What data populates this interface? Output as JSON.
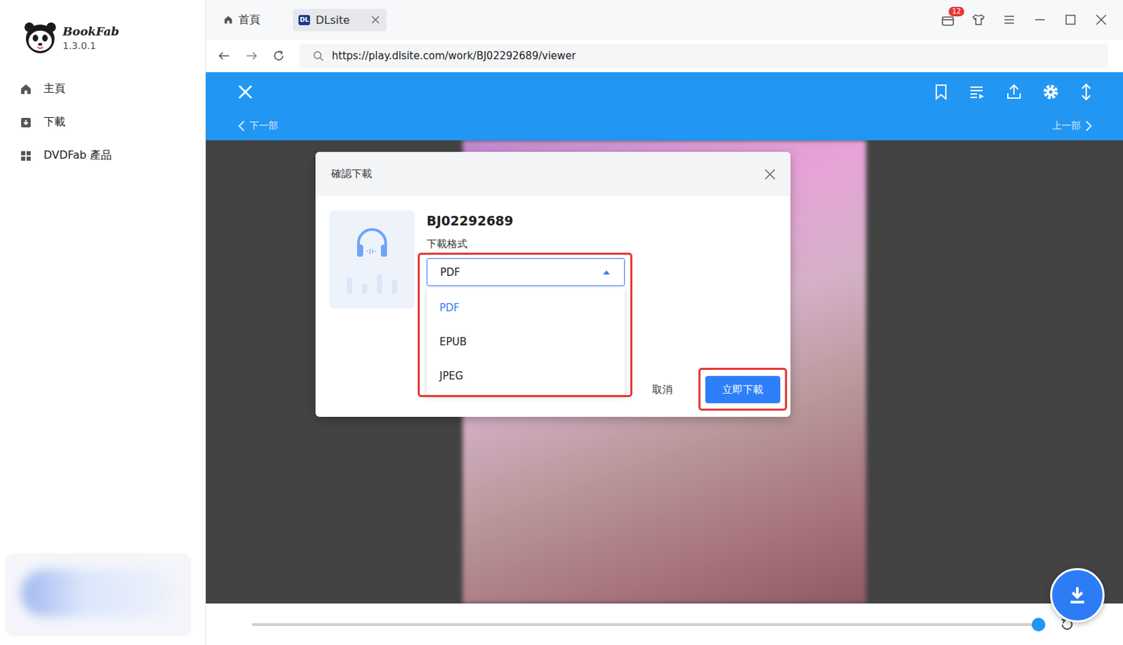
{
  "app": {
    "name": "BookFab",
    "version": "1.3.0.1"
  },
  "sidebar": {
    "items": [
      {
        "label": "主頁",
        "kind": "home",
        "selected": false
      },
      {
        "label": "下載",
        "kind": "download",
        "selected": false
      },
      {
        "label": "DVDFab 產品",
        "kind": "grid",
        "selected": false
      }
    ]
  },
  "tabs": [
    {
      "label": "首頁",
      "kind": "home",
      "badge": "",
      "closable": false,
      "selected": false
    },
    {
      "label": "DLsite",
      "kind": "site",
      "badge": "DL",
      "closable": true,
      "selected": true
    }
  ],
  "notifications": {
    "count": "12"
  },
  "address": {
    "url": "https://play.dlsite.com/work/BJ02292689/viewer"
  },
  "viewer": {
    "prev": "下一部",
    "next": "上一部",
    "progress": {
      "level": 1
    }
  },
  "dialog": {
    "title": "確認下載",
    "item": "BJ02292689",
    "format_label": "下載格式",
    "format": {
      "value": "PDF",
      "expanded": true,
      "highlighted": true,
      "options": [
        {
          "label": "PDF",
          "selected": true
        },
        {
          "label": "EPUB",
          "selected": false
        },
        {
          "label": "JPEG",
          "selected": false
        }
      ]
    },
    "buttons": [
      {
        "label": "取消",
        "primary": false,
        "highlighted": false
      },
      {
        "label": "立即下載",
        "primary": true,
        "highlighted": true
      }
    ]
  }
}
